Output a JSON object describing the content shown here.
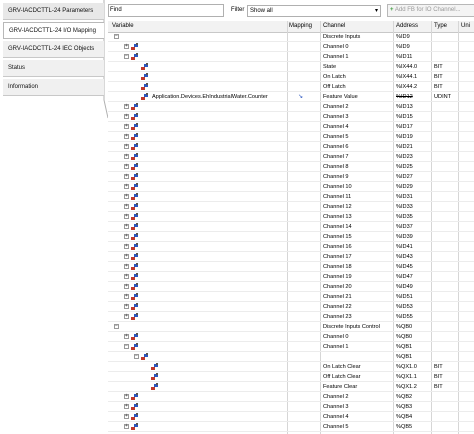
{
  "tabs": [
    {
      "label": "GRV-IACDCTTL-24 Parameters"
    },
    {
      "label": "GRV-IACDCTTL-24 I/O Mapping"
    },
    {
      "label": "GRV-IACDCTTL-24 IEC Objects"
    },
    {
      "label": "Status"
    },
    {
      "label": "Information"
    }
  ],
  "toolbar": {
    "find_label": "Find",
    "filter_label": "Filter",
    "filter_value": "Show all",
    "add_fb_label": "Add FB for IO Channel..."
  },
  "columns": [
    "Variable",
    "Mapping",
    "Channel",
    "Address",
    "Type",
    "Uni"
  ],
  "rows": [
    {
      "indent": 0,
      "exp": "-",
      "icon": false,
      "variable": "",
      "mapping": false,
      "channel": "Discrete Inputs",
      "address": "%ID9",
      "type": ""
    },
    {
      "indent": 1,
      "exp": "+",
      "icon": true,
      "variable": "",
      "mapping": false,
      "channel": "Channel 0",
      "address": "%ID9",
      "type": ""
    },
    {
      "indent": 1,
      "exp": "-",
      "icon": true,
      "variable": "",
      "mapping": false,
      "channel": "Channel 1",
      "address": "%ID11",
      "type": ""
    },
    {
      "indent": 2,
      "exp": "",
      "icon": true,
      "variable": "",
      "mapping": false,
      "channel": "State",
      "address": "%IX44.0",
      "type": "BIT"
    },
    {
      "indent": 2,
      "exp": "",
      "icon": true,
      "variable": "",
      "mapping": false,
      "channel": "On Latch",
      "address": "%IX44.1",
      "type": "BIT"
    },
    {
      "indent": 2,
      "exp": "",
      "icon": true,
      "variable": "",
      "mapping": false,
      "channel": "Off Latch",
      "address": "%IX44.2",
      "type": "BIT"
    },
    {
      "indent": 2,
      "exp": "",
      "icon": true,
      "variable": "Application.Devices.EhIndustrialWater.Counter",
      "mapping": true,
      "channel": "Feature Value",
      "address": "%ID12",
      "type": "UDINT",
      "strike": true
    },
    {
      "indent": 1,
      "exp": "+",
      "icon": true,
      "variable": "",
      "mapping": false,
      "channel": "Channel 2",
      "address": "%ID13",
      "type": ""
    },
    {
      "indent": 1,
      "exp": "+",
      "icon": true,
      "variable": "",
      "mapping": false,
      "channel": "Channel 3",
      "address": "%ID15",
      "type": ""
    },
    {
      "indent": 1,
      "exp": "+",
      "icon": true,
      "variable": "",
      "mapping": false,
      "channel": "Channel 4",
      "address": "%ID17",
      "type": ""
    },
    {
      "indent": 1,
      "exp": "+",
      "icon": true,
      "variable": "",
      "mapping": false,
      "channel": "Channel 5",
      "address": "%ID19",
      "type": ""
    },
    {
      "indent": 1,
      "exp": "+",
      "icon": true,
      "variable": "",
      "mapping": false,
      "channel": "Channel 6",
      "address": "%ID21",
      "type": ""
    },
    {
      "indent": 1,
      "exp": "+",
      "icon": true,
      "variable": "",
      "mapping": false,
      "channel": "Channel 7",
      "address": "%ID23",
      "type": ""
    },
    {
      "indent": 1,
      "exp": "+",
      "icon": true,
      "variable": "",
      "mapping": false,
      "channel": "Channel 8",
      "address": "%ID25",
      "type": ""
    },
    {
      "indent": 1,
      "exp": "+",
      "icon": true,
      "variable": "",
      "mapping": false,
      "channel": "Channel 9",
      "address": "%ID27",
      "type": ""
    },
    {
      "indent": 1,
      "exp": "+",
      "icon": true,
      "variable": "",
      "mapping": false,
      "channel": "Channel 10",
      "address": "%ID29",
      "type": ""
    },
    {
      "indent": 1,
      "exp": "+",
      "icon": true,
      "variable": "",
      "mapping": false,
      "channel": "Channel 11",
      "address": "%ID31",
      "type": ""
    },
    {
      "indent": 1,
      "exp": "+",
      "icon": true,
      "variable": "",
      "mapping": false,
      "channel": "Channel 12",
      "address": "%ID33",
      "type": ""
    },
    {
      "indent": 1,
      "exp": "+",
      "icon": true,
      "variable": "",
      "mapping": false,
      "channel": "Channel 13",
      "address": "%ID35",
      "type": ""
    },
    {
      "indent": 1,
      "exp": "+",
      "icon": true,
      "variable": "",
      "mapping": false,
      "channel": "Channel 14",
      "address": "%ID37",
      "type": ""
    },
    {
      "indent": 1,
      "exp": "+",
      "icon": true,
      "variable": "",
      "mapping": false,
      "channel": "Channel 15",
      "address": "%ID39",
      "type": ""
    },
    {
      "indent": 1,
      "exp": "+",
      "icon": true,
      "variable": "",
      "mapping": false,
      "channel": "Channel 16",
      "address": "%ID41",
      "type": ""
    },
    {
      "indent": 1,
      "exp": "+",
      "icon": true,
      "variable": "",
      "mapping": false,
      "channel": "Channel 17",
      "address": "%ID43",
      "type": ""
    },
    {
      "indent": 1,
      "exp": "+",
      "icon": true,
      "variable": "",
      "mapping": false,
      "channel": "Channel 18",
      "address": "%ID45",
      "type": ""
    },
    {
      "indent": 1,
      "exp": "+",
      "icon": true,
      "variable": "",
      "mapping": false,
      "channel": "Channel 19",
      "address": "%ID47",
      "type": ""
    },
    {
      "indent": 1,
      "exp": "+",
      "icon": true,
      "variable": "",
      "mapping": false,
      "channel": "Channel 20",
      "address": "%ID49",
      "type": ""
    },
    {
      "indent": 1,
      "exp": "+",
      "icon": true,
      "variable": "",
      "mapping": false,
      "channel": "Channel 21",
      "address": "%ID51",
      "type": ""
    },
    {
      "indent": 1,
      "exp": "+",
      "icon": true,
      "variable": "",
      "mapping": false,
      "channel": "Channel 22",
      "address": "%ID53",
      "type": ""
    },
    {
      "indent": 1,
      "exp": "+",
      "icon": true,
      "variable": "",
      "mapping": false,
      "channel": "Channel 23",
      "address": "%ID55",
      "type": ""
    },
    {
      "indent": 0,
      "exp": "-",
      "icon": false,
      "variable": "",
      "mapping": false,
      "channel": "Discrete Inputs Control",
      "address": "%QB0",
      "type": ""
    },
    {
      "indent": 1,
      "exp": "+",
      "icon": true,
      "variable": "",
      "mapping": false,
      "channel": "Channel 0",
      "address": "%QB0",
      "type": ""
    },
    {
      "indent": 1,
      "exp": "-",
      "icon": true,
      "variable": "",
      "mapping": false,
      "channel": "Channel 1",
      "address": "%QB1",
      "type": ""
    },
    {
      "indent": 2,
      "exp": "-",
      "icon": true,
      "variable": "",
      "mapping": false,
      "channel": "",
      "address": "%QB1",
      "type": ""
    },
    {
      "indent": 3,
      "exp": "",
      "icon": true,
      "variable": "",
      "mapping": false,
      "channel": "On Latch Clear",
      "address": "%QX1.0",
      "type": "BIT"
    },
    {
      "indent": 3,
      "exp": "",
      "icon": true,
      "variable": "",
      "mapping": false,
      "channel": "Off Latch Clear",
      "address": "%QX1.1",
      "type": "BIT"
    },
    {
      "indent": 3,
      "exp": "",
      "icon": true,
      "variable": "",
      "mapping": false,
      "channel": "Feature Clear",
      "address": "%QX1.2",
      "type": "BIT"
    },
    {
      "indent": 1,
      "exp": "+",
      "icon": true,
      "variable": "",
      "mapping": false,
      "channel": "Channel 2",
      "address": "%QB2",
      "type": ""
    },
    {
      "indent": 1,
      "exp": "+",
      "icon": true,
      "variable": "",
      "mapping": false,
      "channel": "Channel 3",
      "address": "%QB3",
      "type": ""
    },
    {
      "indent": 1,
      "exp": "+",
      "icon": true,
      "variable": "",
      "mapping": false,
      "channel": "Channel 4",
      "address": "%QB4",
      "type": ""
    },
    {
      "indent": 1,
      "exp": "+",
      "icon": true,
      "variable": "",
      "mapping": false,
      "channel": "Channel 5",
      "address": "%QB5",
      "type": ""
    }
  ]
}
